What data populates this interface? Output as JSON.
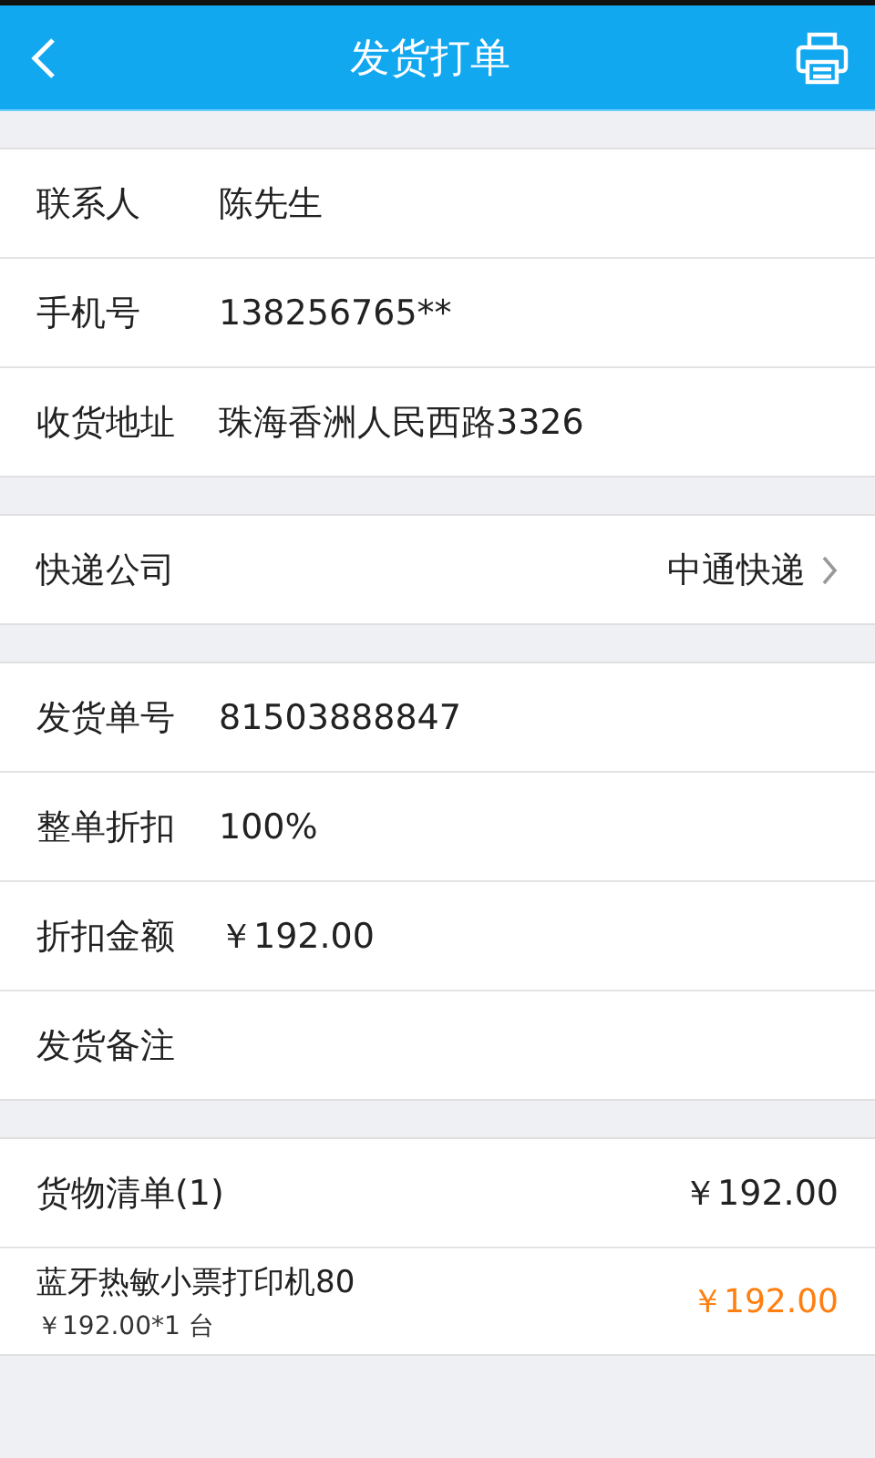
{
  "header": {
    "title": "发货打单"
  },
  "sections": [
    {
      "rows": [
        {
          "kind": "field",
          "label": "联系人",
          "value": "陈先生"
        },
        {
          "kind": "field",
          "label": "手机号",
          "value": "138256765**"
        },
        {
          "kind": "field",
          "label": "收货地址",
          "value": "珠海香洲人民西路3326"
        }
      ]
    },
    {
      "rows": [
        {
          "kind": "link",
          "label": "快递公司",
          "value": "中通快递"
        }
      ]
    },
    {
      "rows": [
        {
          "kind": "field",
          "label": "发货单号",
          "value": "81503888847"
        },
        {
          "kind": "field",
          "label": "整单折扣",
          "value": "100%"
        },
        {
          "kind": "field",
          "label": "折扣金额",
          "value": "￥192.00"
        },
        {
          "kind": "field",
          "label": "发货备注"
        }
      ]
    }
  ],
  "goods": {
    "title": "货物清单(1)",
    "total": "￥192.00",
    "items": [
      {
        "name": "蓝牙热敏小票打印机80",
        "detail": "￥192.00*1 台",
        "price": "￥192.00"
      }
    ]
  }
}
